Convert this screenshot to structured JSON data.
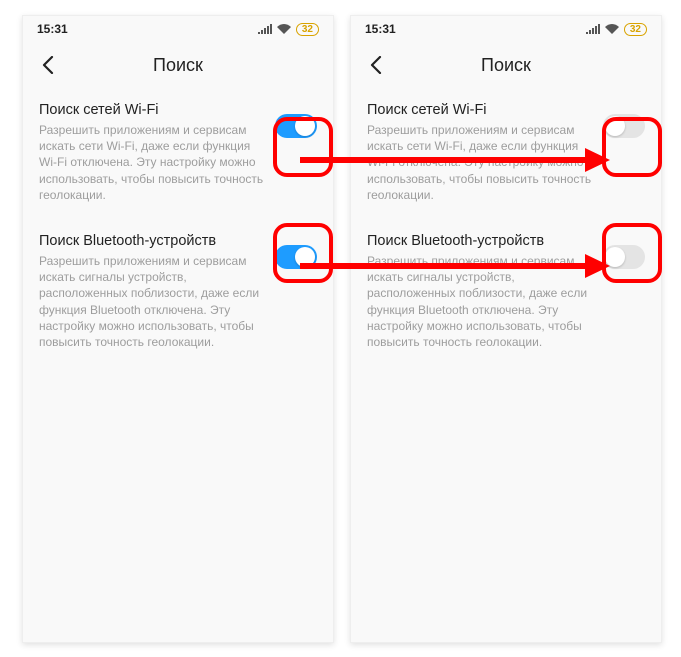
{
  "status": {
    "time": "15:31",
    "battery": "32"
  },
  "header": {
    "title": "Поиск"
  },
  "settings": {
    "wifi": {
      "title": "Поиск сетей Wi-Fi",
      "desc": "Разрешить приложениям и сервисам искать сети Wi-Fi, даже если функция Wi-Fi отключена. Эту настройку можно использовать, чтобы повысить точность геолокации."
    },
    "bt": {
      "title": "Поиск Bluetooth-устройств",
      "desc": "Разрешить приложениям и сервисам искать сигналы устройств, расположенных поблизости, даже если функция Bluetooth отключена. Эту настройку можно использовать, чтобы повысить точность геолокации."
    }
  },
  "screens": {
    "left": {
      "wifi_on": true,
      "bt_on": true
    },
    "right": {
      "wifi_on": false,
      "bt_on": false
    }
  }
}
